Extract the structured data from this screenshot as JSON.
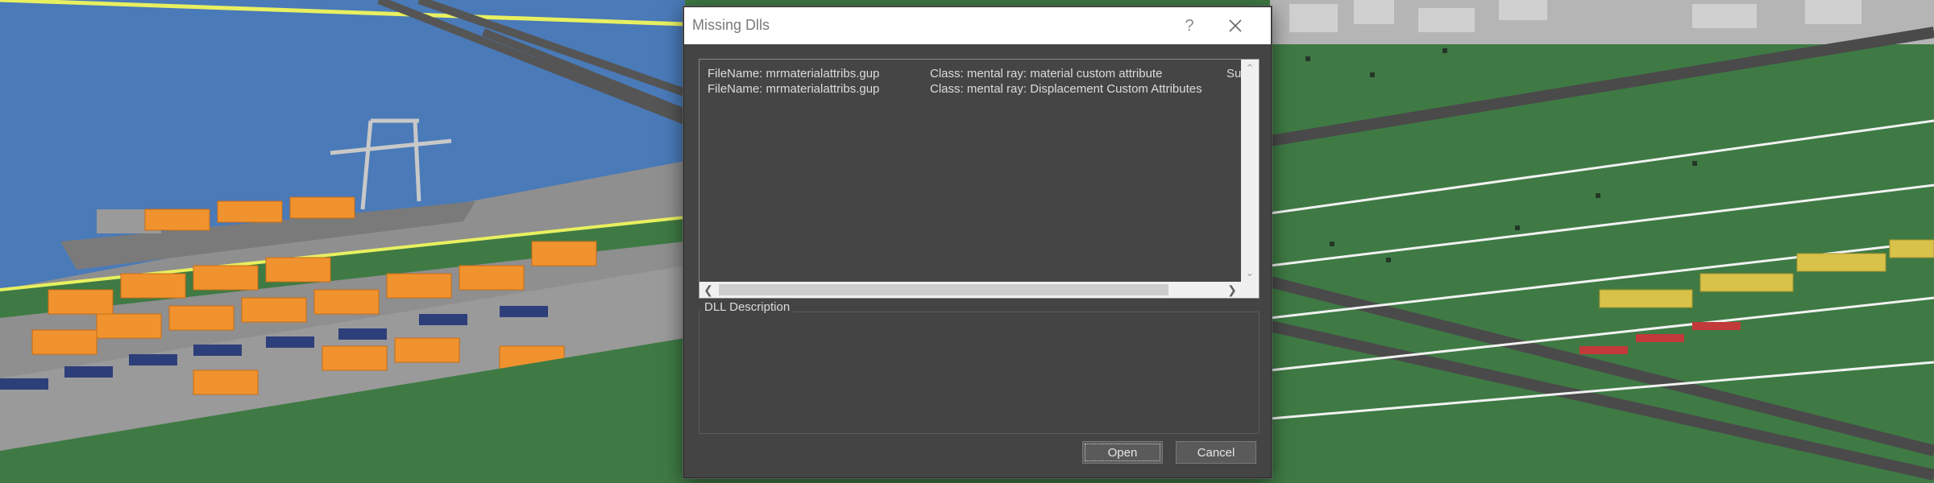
{
  "dialog": {
    "title": "Missing Dlls",
    "help_glyph": "?",
    "close_icon": "close-icon",
    "list": [
      {
        "filename": "FileName:  mrmaterialattribs.gup",
        "class": "Class: mental ray: material custom attribute",
        "extra": "Sup"
      },
      {
        "filename": "FileName:  mrmaterialattribs.gup",
        "class": "Class: mental ray: Displacement Custom Attributes",
        "extra": ""
      }
    ],
    "description_label": "DLL Description",
    "description_text": "",
    "buttons": {
      "open": "Open",
      "cancel": "Cancel"
    }
  },
  "colors": {
    "water": "#4a7ab8",
    "grass": "#3f7a44",
    "dialog_bg": "#444444",
    "container": "#f0922e",
    "title_bar": "#ffffff"
  }
}
